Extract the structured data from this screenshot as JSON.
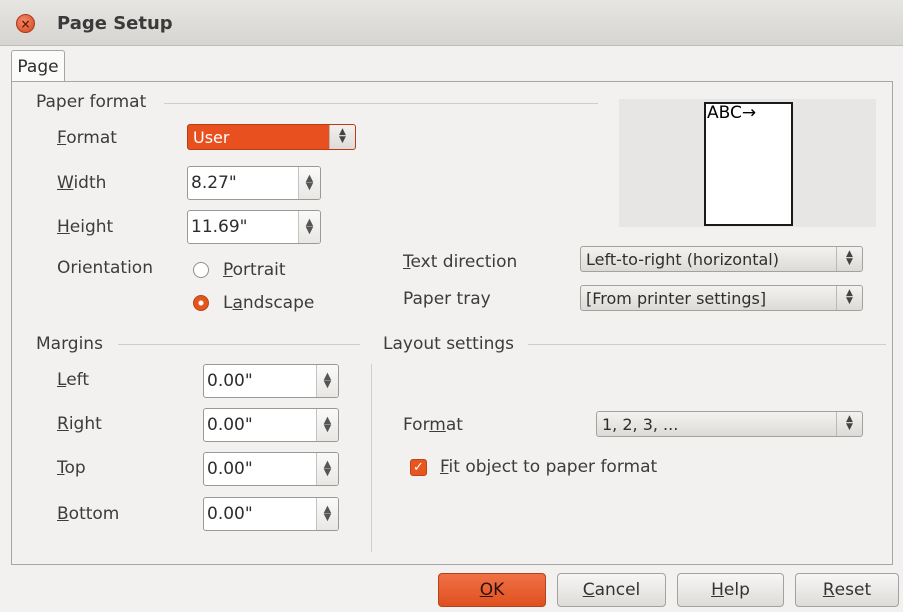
{
  "window": {
    "title": "Page Setup"
  },
  "tabs": [
    {
      "label": "Page"
    }
  ],
  "paper_format": {
    "section_title": "Paper format",
    "format_label_u": "F",
    "format_label_rest": "ormat",
    "format_value": "User",
    "width_label_u": "W",
    "width_label_rest": "idth",
    "width_value": "8.27\"",
    "height_label_u": "H",
    "height_label_rest": "eight",
    "height_value": "11.69\"",
    "orientation_label": "Orientation",
    "portrait_u": "P",
    "portrait_rest": "ortrait",
    "landscape_pre": "L",
    "landscape_u": "a",
    "landscape_rest": "ndscape",
    "selected_orientation": "Landscape"
  },
  "preview": {
    "text": "ABC→"
  },
  "text_direction": {
    "label_u": "T",
    "label_rest": "ext direction",
    "value": "Left-to-right (horizontal)"
  },
  "paper_tray": {
    "label": "Paper tray",
    "value": "[From printer settings]"
  },
  "margins": {
    "section_title": "Margins",
    "left_u": "L",
    "left_rest": "eft",
    "left_value": "0.00\"",
    "right_u": "R",
    "right_rest": "ight",
    "right_value": "0.00\"",
    "top_u": "T",
    "top_rest": "op",
    "top_value": "0.00\"",
    "bottom_u": "B",
    "bottom_rest": "ottom",
    "bottom_value": "0.00\""
  },
  "layout_settings": {
    "section_title": "Layout settings",
    "format_pre": "For",
    "format_u": "m",
    "format_rest": "at",
    "format_value": "1, 2, 3, ...",
    "fit_u": "F",
    "fit_rest": "it object to paper format",
    "fit_checked": true
  },
  "buttons": {
    "ok_u": "O",
    "ok_rest": "K",
    "cancel_u": "C",
    "cancel_rest": "ancel",
    "help_u": "H",
    "help_rest": "elp",
    "reset_u": "R",
    "reset_rest": "eset"
  },
  "colors": {
    "accent": "#e9501f",
    "window_bg": "#f2f1f0"
  }
}
